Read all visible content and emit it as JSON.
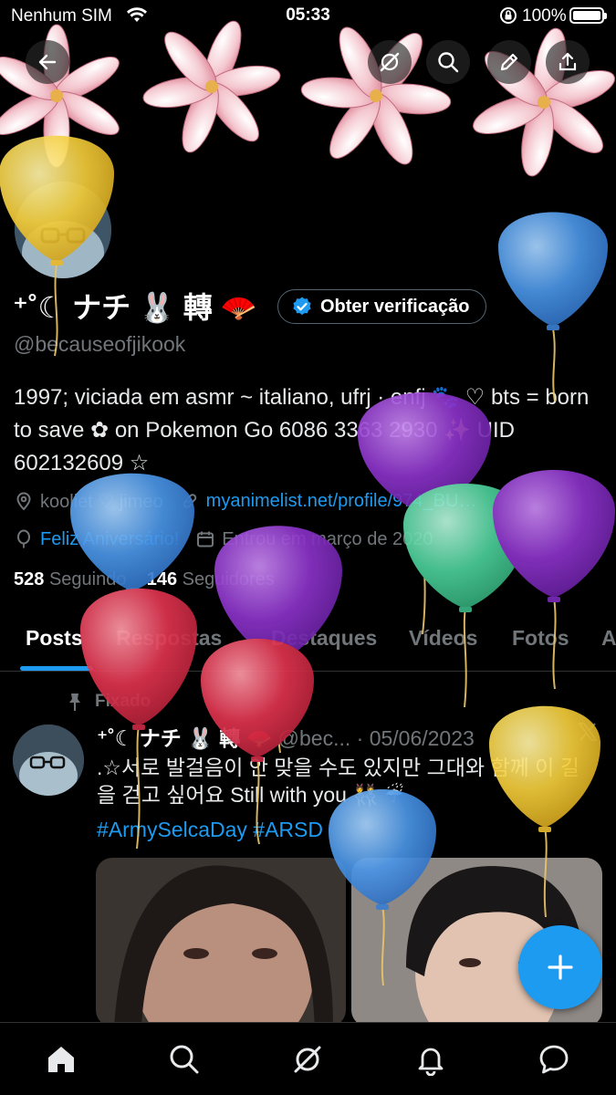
{
  "status_bar": {
    "carrier": "Nenhum SIM",
    "time": "05:33",
    "battery": "100%"
  },
  "profile": {
    "display_name": "⁺˚☾ ナチ 🐰 轉 🪭",
    "verify_label": "Obter verificação",
    "handle": "@becauseofjikook",
    "bio": "1997; viciada em asmr ~ italiano, ufrj · enfj 🐾 ♡ bts = born to save ✿ on Pokemon Go 6086 3363 2930 ✨ UID 602132609 ☆",
    "location": "kooliet ♡ jimeo",
    "website": "myanimelist.net/profile/974_BU…",
    "birthday": "Feliz Aniversário!",
    "joined": "Entrou em março de 2020",
    "following_count": "528",
    "following_label": "Seguindo",
    "followers_count": "146",
    "followers_label": "Seguidores"
  },
  "tabs": [
    "Posts",
    "Respostas",
    "Destaques",
    "Vídeos",
    "Fotos",
    "A"
  ],
  "post": {
    "pinned_label": "Fixado",
    "author": "⁺˚☾ ナチ 🐰 轉 🪭",
    "handle_date": "@bec... · 05/06/2023",
    "text": ".☆서로 발걸음이 안 맞을 수도 있지만 그대와 함께 이 길을 걷고 싶어요 Still with you 👯 ☔",
    "tags": "#ArmySelcaDay #ARSD"
  },
  "colors": {
    "accent": "#1d9bf0",
    "background": "#000000",
    "muted": "#71767b"
  },
  "icons": {
    "back": "arrow-left-icon",
    "grok": "grok-icon",
    "search": "search-icon",
    "edit": "pencil-icon",
    "share": "share-icon",
    "fab": "plus-icon",
    "nav": [
      "home-icon",
      "search-icon",
      "grok-icon",
      "bell-icon",
      "chat-icon"
    ]
  }
}
